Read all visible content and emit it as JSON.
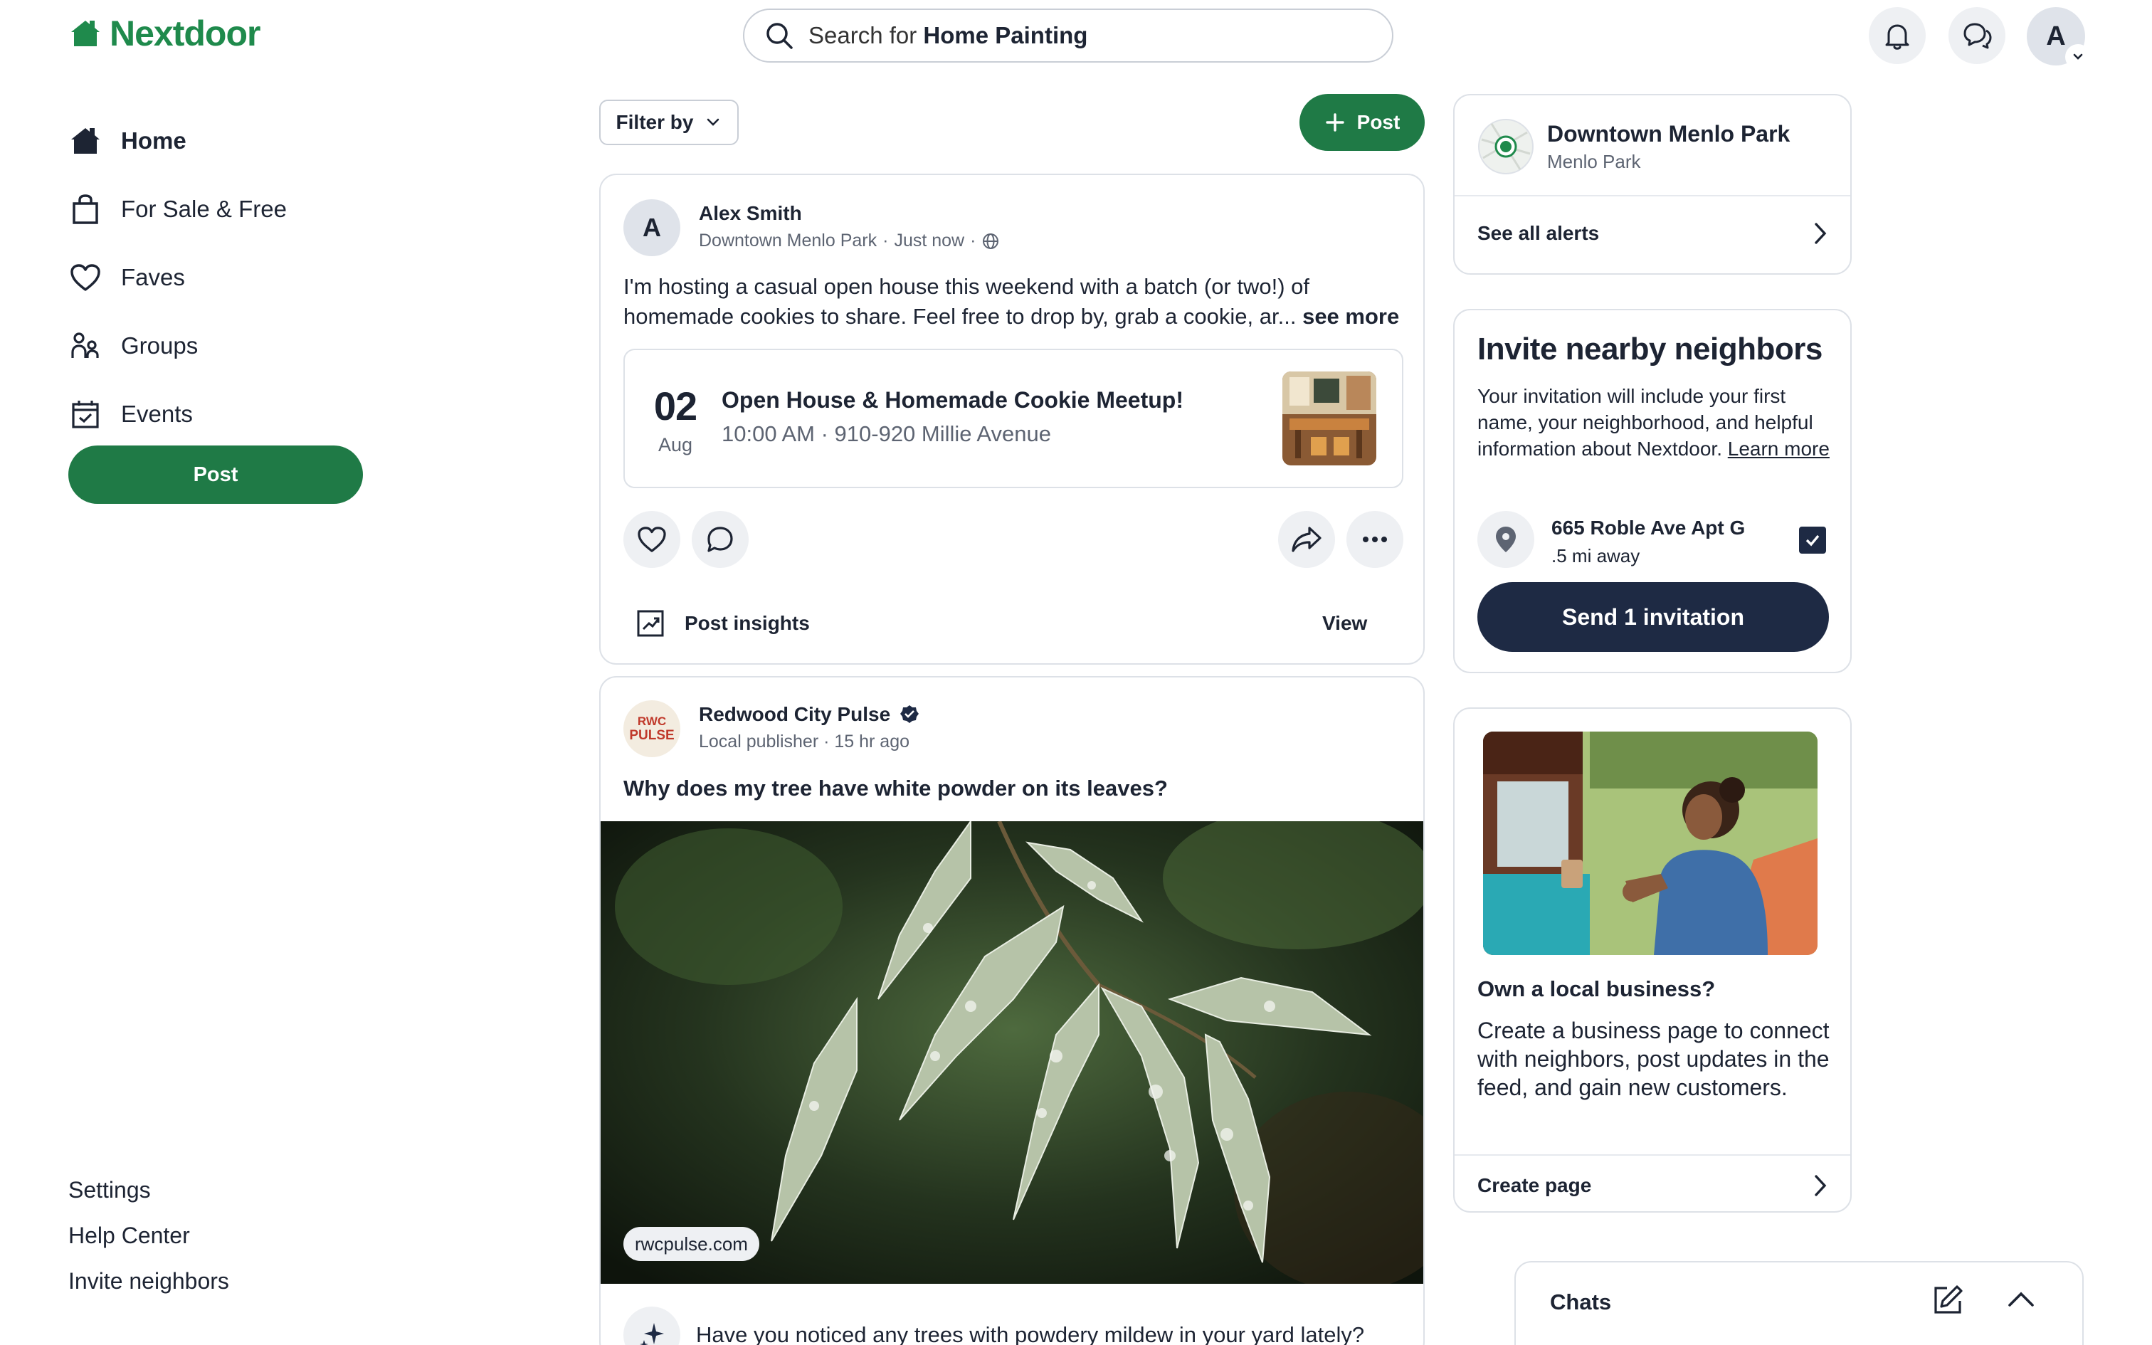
{
  "header": {
    "brand": "Nextdoor",
    "search_prefix": "Search for ",
    "search_term": "Home Painting",
    "avatar_letter": "A"
  },
  "nav": {
    "items": [
      {
        "label": "Home",
        "icon": "home-icon"
      },
      {
        "label": "For Sale & Free",
        "icon": "shopping-bag-icon"
      },
      {
        "label": "Faves",
        "icon": "heart-icon"
      },
      {
        "label": "Groups",
        "icon": "groups-icon"
      },
      {
        "label": "Events",
        "icon": "calendar-icon"
      }
    ],
    "post_label": "Post",
    "footer_links": [
      "Settings",
      "Help Center",
      "Invite neighbors"
    ]
  },
  "feed": {
    "filter_label": "Filter by",
    "post_label": "Post",
    "post1": {
      "avatar_letter": "A",
      "author": "Alex Smith",
      "neighborhood": "Downtown Menlo Park",
      "sep": "·",
      "time": "Just now",
      "body_line1": "I'm hosting a casual open house this weekend with a batch (or two!) of",
      "body_line2": "homemade cookies to share. Feel free to drop by, grab a cookie, ar...",
      "see_more": "see more",
      "event": {
        "day": "02",
        "month": "Aug",
        "title": "Open House & Homemade Cookie Meetup!",
        "details": "10:00 AM · 910-920 Millie Avenue"
      },
      "insights_label": "Post insights",
      "view_label": "View"
    },
    "post2": {
      "avatar_text_top": "RWC",
      "avatar_text_bottom": "PULSE",
      "author": "Redwood City Pulse",
      "meta": "Local publisher · 15 hr ago",
      "title": "Why does my tree have white powder on its leaves?",
      "source": "rwcpulse.com",
      "prompt": "Have you noticed any trees with powdery mildew in your yard lately?"
    }
  },
  "right": {
    "alerts": {
      "title": "Downtown Menlo Park",
      "subtitle": "Menlo Park",
      "see_all": "See all alerts"
    },
    "invite": {
      "title": "Invite nearby neighbors",
      "desc": "Your invitation will include your first name, your neighborhood, and helpful information about Nextdoor.",
      "learn_more": "Learn more",
      "address": "665 Roble Ave Apt G",
      "distance": ".5 mi away",
      "send_label": "Send 1 invitation"
    },
    "business": {
      "title": "Own a local business?",
      "desc": "Create a business page to connect with neighbors, post updates in the feed, and gain new customers.",
      "cta": "Create page"
    },
    "chats": {
      "title": "Chats"
    }
  },
  "colors": {
    "brand_green": "#1f7a46",
    "navy": "#1e2a44",
    "border": "#dde1e7"
  }
}
